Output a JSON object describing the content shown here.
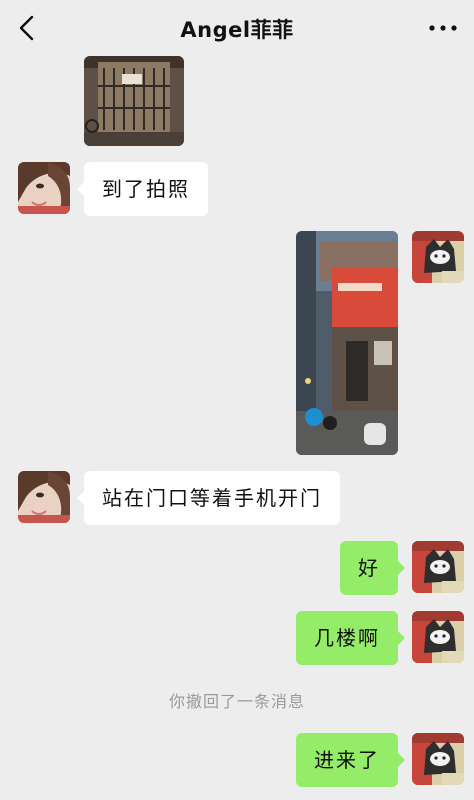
{
  "header": {
    "title": "Angel菲菲",
    "back_icon": "chevron-left-icon",
    "more_icon": "more-dots-icon"
  },
  "messages": [
    {
      "type": "image",
      "from": "contact",
      "subject": "building-gate-photo"
    },
    {
      "type": "text",
      "from": "contact",
      "text": "到了拍照"
    },
    {
      "type": "image",
      "from": "me",
      "subject": "street-storefront-photo"
    },
    {
      "type": "text",
      "from": "contact",
      "text": "站在门口等着手机开门"
    },
    {
      "type": "text",
      "from": "me",
      "text": "好"
    },
    {
      "type": "text",
      "from": "me",
      "text": "几楼啊"
    },
    {
      "type": "system",
      "text": "你撤回了一条消息"
    },
    {
      "type": "text",
      "from": "me",
      "text": "进来了"
    }
  ],
  "colors": {
    "background": "#ededed",
    "incoming_bubble": "#ffffff",
    "outgoing_bubble": "#95ec69",
    "system_text": "#9a9a9a"
  }
}
